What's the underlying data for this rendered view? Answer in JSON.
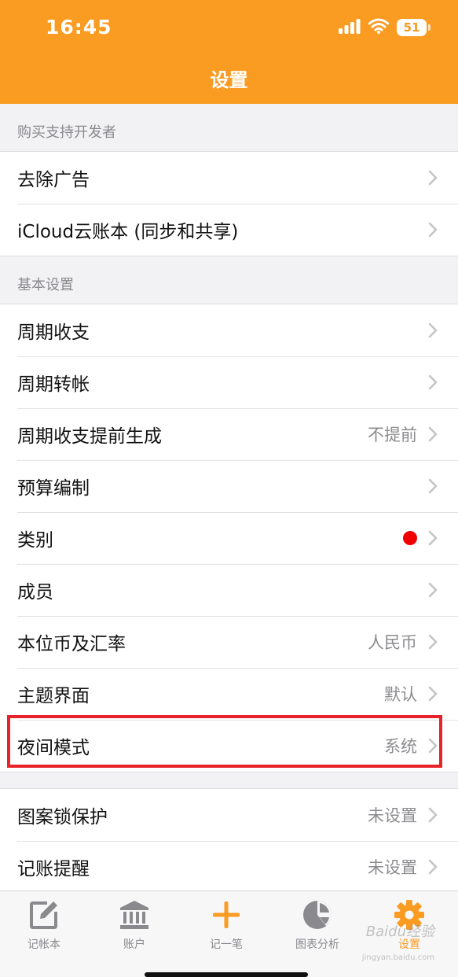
{
  "status_bar": {
    "time": "16:45",
    "battery": "51"
  },
  "nav": {
    "title": "设置"
  },
  "sections": [
    {
      "header": "购买支持开发者",
      "rows": [
        {
          "label": "去除广告",
          "value": ""
        },
        {
          "label": "iCloud云账本 (同步和共享)",
          "value": ""
        }
      ]
    },
    {
      "header": "基本设置",
      "rows": [
        {
          "label": "周期收支",
          "value": ""
        },
        {
          "label": "周期转帐",
          "value": ""
        },
        {
          "label": "周期收支提前生成",
          "value": "不提前"
        },
        {
          "label": "预算编制",
          "value": ""
        },
        {
          "label": "类别",
          "value": ""
        },
        {
          "label": "成员",
          "value": ""
        },
        {
          "label": "本位币及汇率",
          "value": "人民币"
        },
        {
          "label": "主题界面",
          "value": "默认"
        },
        {
          "label": "夜间模式",
          "value": "系统"
        }
      ]
    },
    {
      "header": "",
      "rows": [
        {
          "label": "图案锁保护",
          "value": "未设置"
        },
        {
          "label": "记账提醒",
          "value": "未设置"
        }
      ]
    }
  ],
  "tabbar": {
    "items": [
      {
        "label": "记帐本",
        "icon": "edit-icon"
      },
      {
        "label": "账户",
        "icon": "bank-icon"
      },
      {
        "label": "记一笔",
        "icon": "plus-icon"
      },
      {
        "label": "图表分析",
        "icon": "pie-chart-icon"
      },
      {
        "label": "设置",
        "icon": "gear-icon"
      }
    ]
  },
  "watermark": {
    "text": "Baidu经验",
    "sub": "jingyan.baidu.com"
  },
  "colors": {
    "accent": "#fa9b22",
    "highlight": "#e8222a",
    "badge": "#f00000"
  }
}
